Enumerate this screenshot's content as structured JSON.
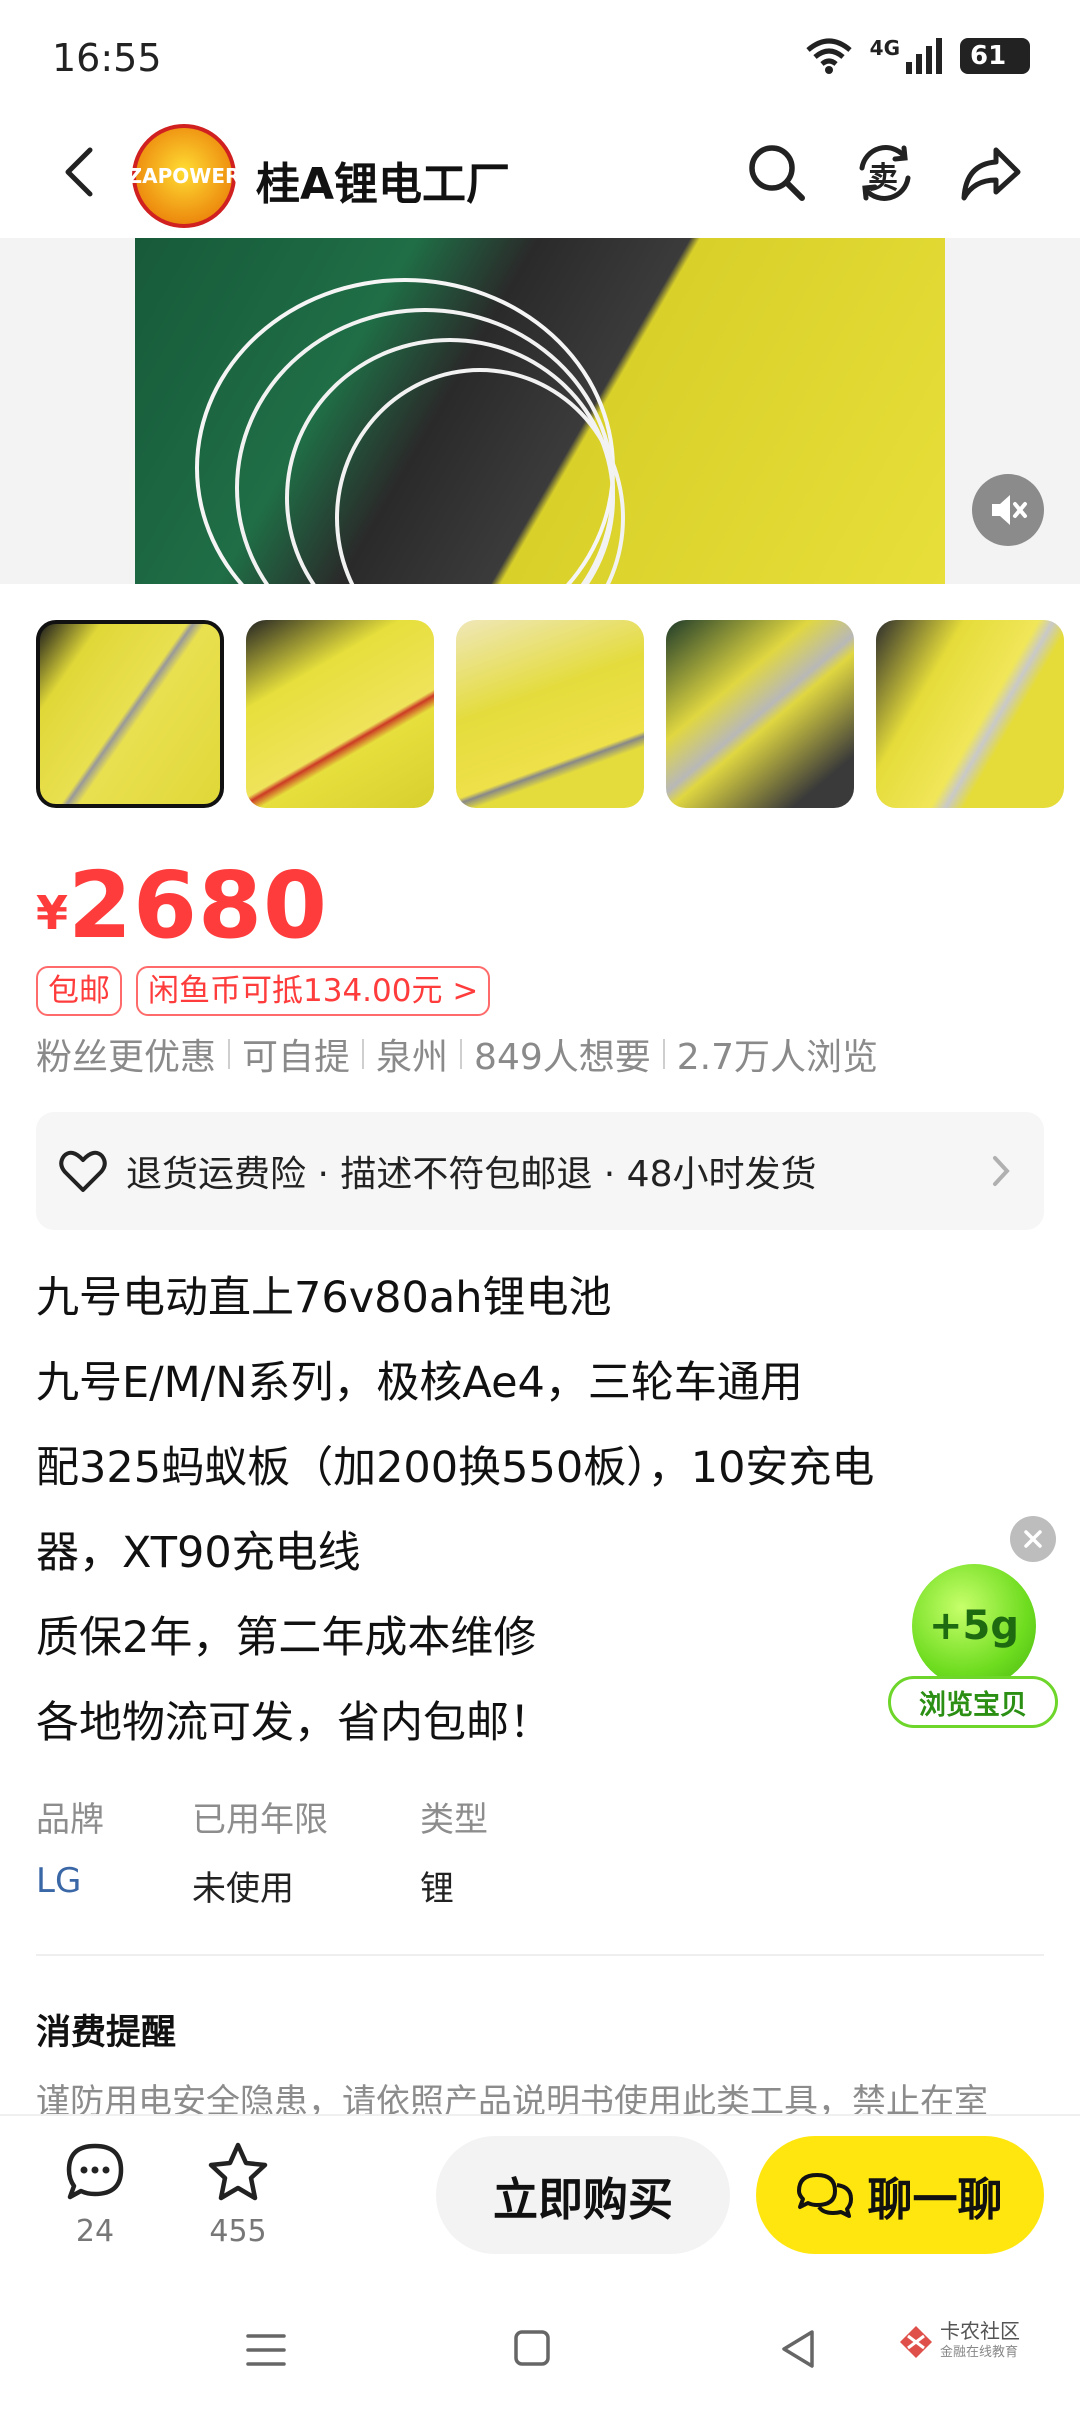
{
  "status_bar": {
    "time": "16:55",
    "network": "4G",
    "battery": "61"
  },
  "header": {
    "shop_name": "桂A锂电工厂",
    "logo_text": "ZAPOWER",
    "sell_icon_label": "卖"
  },
  "listing": {
    "price_currency": "¥",
    "price": "2680",
    "tags": [
      "包邮",
      "闲鱼币可抵134.00元 >"
    ],
    "meta": [
      "粉丝更优惠",
      "可自提",
      "泉州",
      "849人想要",
      "2.7万人浏览"
    ],
    "guarantee": "退货运费险 · 描述不符包邮退 · 48小时发货",
    "description": [
      "九号电动直上76v80ah锂电池",
      "九号E/M/N系列，极核Ae4，三轮车通用",
      "配325蚂蚁板（加200换550板），10安充电",
      "器，XT90充电线",
      "质保2年，第二年成本维修",
      "各地物流可发，省内包邮！"
    ],
    "attributes": [
      {
        "key": "品牌",
        "value": "LG"
      },
      {
        "key": "已用年限",
        "value": "未使用"
      },
      {
        "key": "类型",
        "value": "锂"
      }
    ],
    "notice_title": "消费提醒",
    "notice_text": "谨防用电安全隐患，请依照产品说明书使用此类工具，禁止在室"
  },
  "floating_reward": {
    "badge": "+5g",
    "label": "浏览宝贝"
  },
  "bottom_bar": {
    "comment_count": "24",
    "favorite_count": "455",
    "buy_label": "立即购买",
    "chat_label": "聊一聊"
  },
  "watermark": {
    "line1": "卡农社区",
    "line2": "金融在线教育"
  },
  "colors": {
    "price": "#ff3c3c",
    "chat_button": "#ffe60f",
    "reward_green": "#6ed62a"
  }
}
